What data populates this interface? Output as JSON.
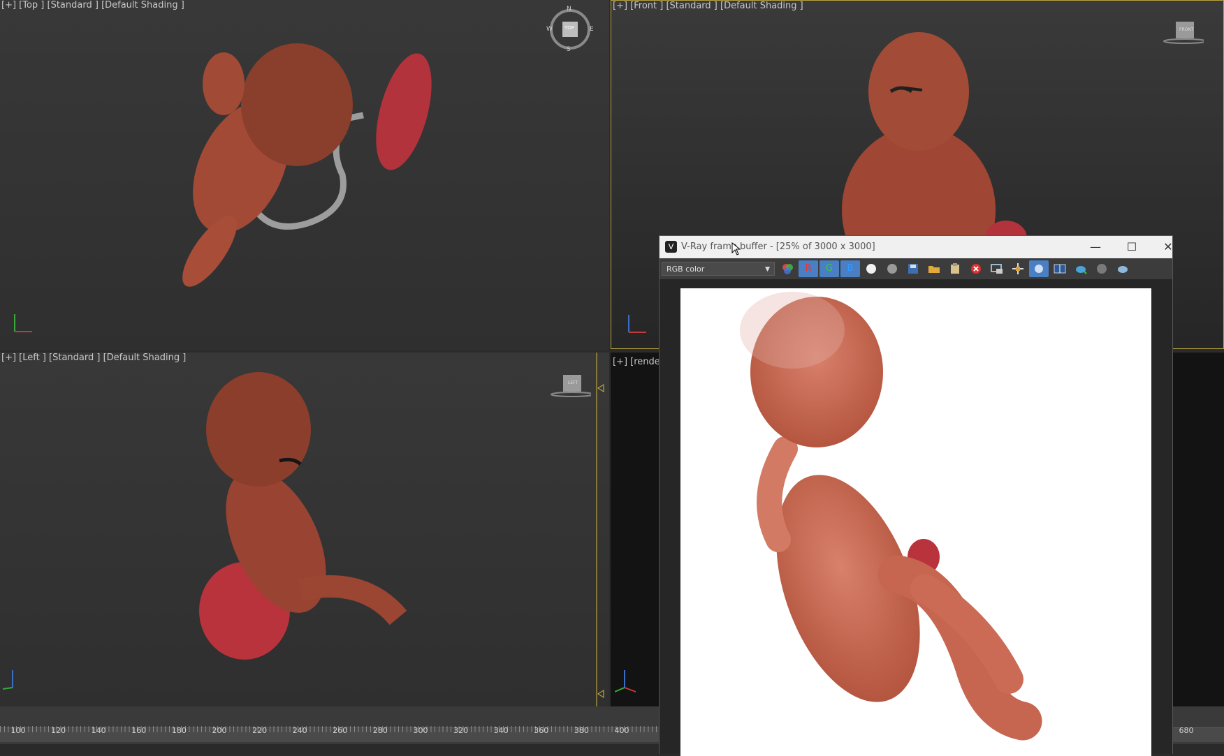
{
  "viewports": {
    "top": {
      "label": "[+] [Top ] [Standard ] [Default Shading ]",
      "compass": {
        "n": "N",
        "s": "S",
        "e": "E",
        "w": "W",
        "cube": "TOP"
      }
    },
    "front": {
      "label": "[+] [Front ] [Standard ] [Default Shading ]",
      "cube": "FRONT"
    },
    "left": {
      "label": "[+] [Left ] [Standard ] [Default Shading ]",
      "cube": "LEFT"
    },
    "render": {
      "label": "[+] [render"
    }
  },
  "timeline": {
    "ticks": [
      "100",
      "120",
      "140",
      "160",
      "180",
      "200",
      "220",
      "240",
      "260",
      "280",
      "300",
      "320",
      "340",
      "360",
      "380",
      "400"
    ],
    "right_tick": "680"
  },
  "framebuffer": {
    "title": "V-Ray frame buffer - [25% of 3000 x 3000]",
    "channel": "RGB color",
    "buttons": {
      "minimize": "—",
      "maximize": "☐",
      "close": "✕",
      "r": "R",
      "g": "G",
      "b": "B"
    }
  },
  "colors": {
    "accent_blue": "#4a7fc4",
    "viewport_border": "#b9a33b",
    "skin": "#b4553f"
  }
}
